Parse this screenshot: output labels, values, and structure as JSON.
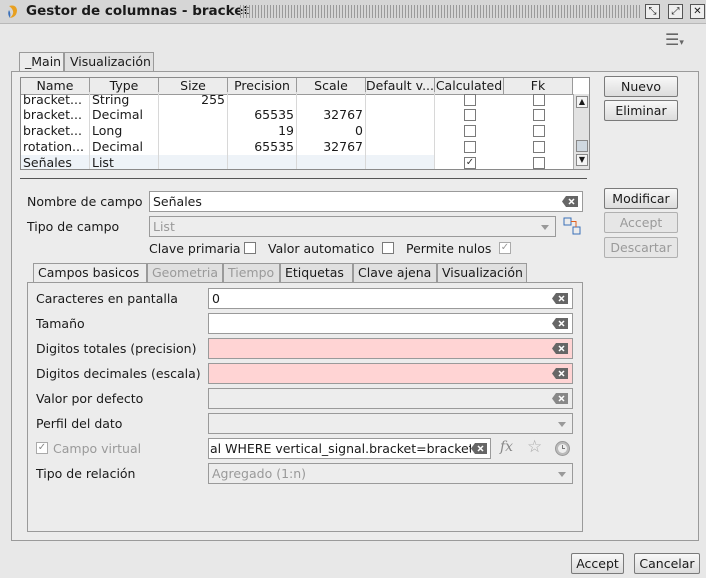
{
  "window": {
    "title": "Gestor de columnas - bracket"
  },
  "tabs_main": [
    "_Main",
    "Visualización"
  ],
  "grid": {
    "columns": [
      "Name",
      "Type",
      "Size",
      "Precision",
      "Scale",
      "Default v...",
      "Calculated",
      "Fk"
    ],
    "rows": [
      {
        "name": "bracket...",
        "type": "String",
        "size": "255",
        "precision": "",
        "scale": "",
        "calculated": false,
        "fk": false
      },
      {
        "name": "bracket...",
        "type": "Decimal",
        "size": "",
        "precision": "65535",
        "scale": "32767",
        "calculated": false,
        "fk": false
      },
      {
        "name": "bracket...",
        "type": "Long",
        "size": "",
        "precision": "19",
        "scale": "0",
        "calculated": false,
        "fk": false
      },
      {
        "name": "rotation...",
        "type": "Decimal",
        "size": "",
        "precision": "65535",
        "scale": "32767",
        "calculated": false,
        "fk": false
      },
      {
        "name": "Señales",
        "type": "List",
        "size": "",
        "precision": "",
        "scale": "",
        "calculated": true,
        "fk": false
      }
    ]
  },
  "buttons_side": {
    "nuevo": "Nuevo",
    "eliminar": "Eliminar",
    "modificar": "Modificar",
    "accept": "Accept",
    "descartar": "Descartar"
  },
  "form": {
    "nombre_label": "Nombre de campo",
    "nombre_value": "Señales",
    "tipo_label": "Tipo de campo",
    "tipo_value": "List",
    "clave_primaria": "Clave primaria",
    "valor_automatico": "Valor automatico",
    "permite_nulos": "Permite nulos"
  },
  "tabs_inner": [
    "Campos basicos",
    "Geometria",
    "Tiempo",
    "Etiquetas",
    "Clave ajena",
    "Visualización"
  ],
  "inner": {
    "caracteres_label": "Caracteres en pantalla",
    "caracteres_value": "0",
    "tamano_label": "Tamaño",
    "digitos_totales_label": "Digitos totales (precision)",
    "digitos_decimales_label": "Digitos decimales (escala)",
    "valor_defecto_label": "Valor por defecto",
    "perfil_label": "Perfil del dato",
    "campo_virtual_label": "Campo virtual",
    "campo_virtual_value": "al WHERE vertical_signal.bracket=bracket.",
    "fx": "fx",
    "tipo_relacion_label": "Tipo de relación",
    "tipo_relacion_value": "Agregado (1:n)"
  },
  "footer": {
    "accept": "Accept",
    "cancel": "Cancelar"
  },
  "colors": {
    "required_field": "#ffd4d4"
  }
}
